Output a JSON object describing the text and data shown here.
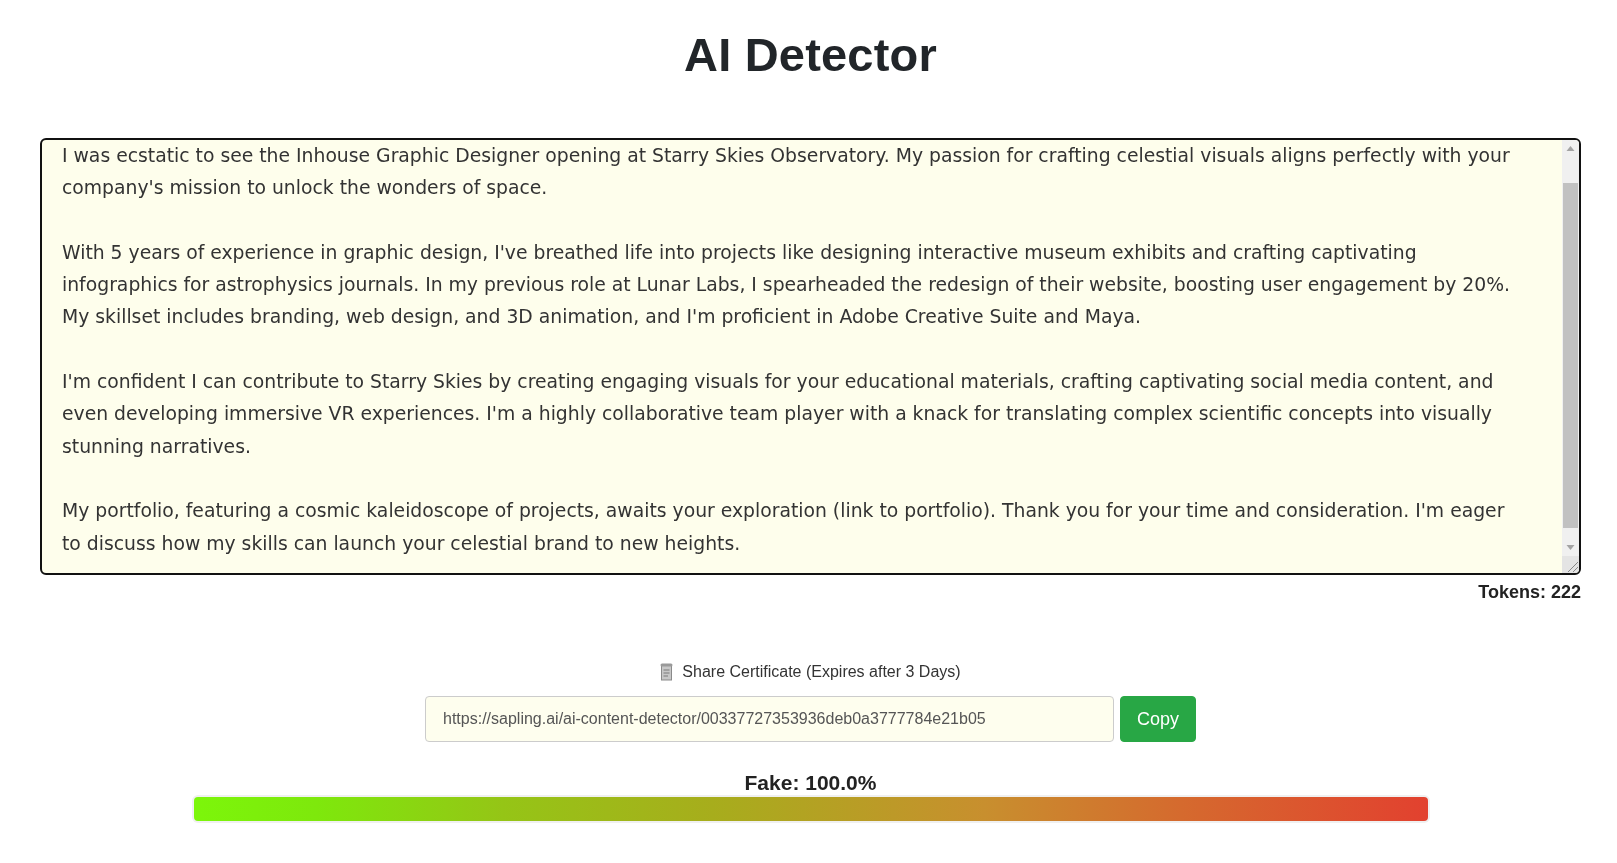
{
  "title": "AI Detector",
  "editor": {
    "paragraphs": [
      "I was ecstatic to see the Inhouse Graphic Designer opening at Starry Skies Observatory. My passion for crafting celestial visuals aligns perfectly with your company's mission to unlock the wonders of space.",
      "With 5 years of experience in graphic design, I've breathed life into projects like designing interactive museum exhibits and crafting captivating infographics for astrophysics journals. In my previous role at Lunar Labs, I spearheaded the redesign of their website, boosting user engagement by 20%. My skillset includes branding, web design, and 3D animation, and I'm proficient in Adobe Creative Suite and Maya.",
      "I'm confident I can contribute to Starry Skies by creating engaging visuals for your educational materials, crafting captivating social media content, and even developing immersive VR experiences. I'm a highly collaborative team player with a knack for translating complex scientific concepts into visually stunning narratives.",
      "My portfolio, featuring a cosmic kaleidoscope of projects, awaits your exploration (link to portfolio). Thank you for your time and consideration. I'm eager to discuss how my skills can launch your celestial brand to new heights."
    ],
    "token_count": "Tokens: 222"
  },
  "share": {
    "label": "Share Certificate (Expires after 3 Days)",
    "url": "https://sapling.ai/ai-content-detector/00337727353936deb0a3777784e21b05",
    "button": "Copy"
  },
  "result": {
    "label": "Fake: 100.0%",
    "level": 1
  }
}
